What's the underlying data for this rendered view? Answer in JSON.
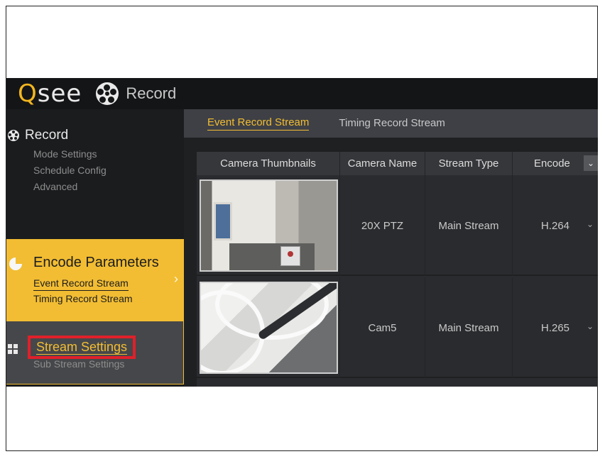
{
  "header": {
    "logo_q": "Q",
    "logo_rest": "see",
    "title": "Record"
  },
  "sidebar": {
    "section_title": "Record",
    "items": [
      "Mode Settings",
      "Schedule Config",
      "Advanced"
    ],
    "encode": {
      "title": "Encode Parameters",
      "items": [
        "Event Record Stream",
        "Timing Record Stream"
      ]
    },
    "stream": {
      "title": "Stream Settings",
      "sub": "Sub Stream Settings"
    }
  },
  "tabs": [
    "Event Record Stream",
    "Timing Record Stream"
  ],
  "table": {
    "headers": [
      "Camera Thumbnails",
      "Camera Name",
      "Stream Type",
      "Encode"
    ],
    "rows": [
      {
        "name": "20X PTZ",
        "stream": "Main Stream",
        "encode": "H.264"
      },
      {
        "name": "Cam5",
        "stream": "Main Stream",
        "encode": "H.265"
      }
    ]
  },
  "colors": {
    "accent": "#f2bd33",
    "highlight": "#e0202a"
  }
}
